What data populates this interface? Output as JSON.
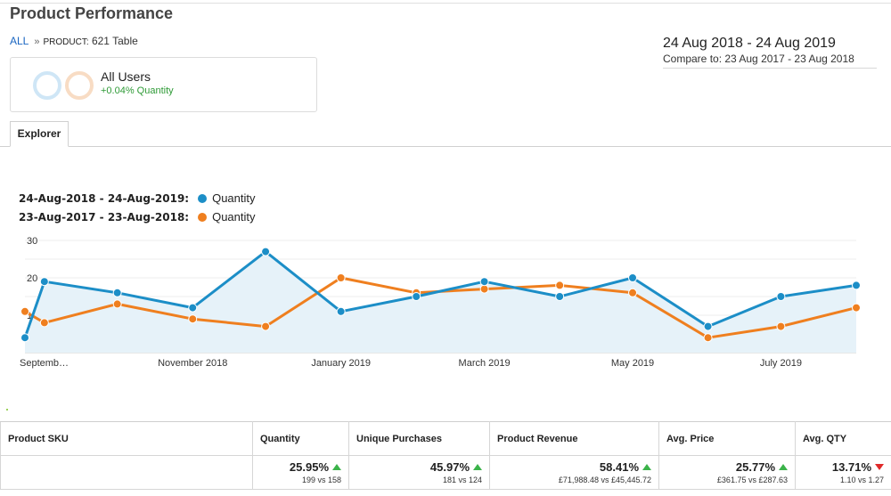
{
  "page": {
    "title": "Product Performance"
  },
  "breadcrumb": {
    "root": "ALL",
    "separator": "»",
    "key": "PRODUCT:",
    "value": "621 Table"
  },
  "date_range": {
    "main": "24 Aug 2018 - 24 Aug 2019",
    "compare": "Compare to: 23 Aug 2017 - 23 Aug 2018"
  },
  "segment": {
    "name": "All Users",
    "delta": "+0.04% Quantity"
  },
  "tabs": [
    {
      "label": "Explorer"
    }
  ],
  "colors": {
    "current": "#1c8ec7",
    "previous": "#ef7f1f",
    "up": "#3bb34a",
    "down": "#e02a2a"
  },
  "legend": [
    {
      "range": "24-Aug-2018 - 24-Aug-2019:",
      "metric": "Quantity",
      "color": "#1c8ec7"
    },
    {
      "range": "23-Aug-2017 - 23-Aug-2018:",
      "metric": "Quantity",
      "color": "#ef7f1f"
    }
  ],
  "chart_data": {
    "type": "line",
    "title": "",
    "xlabel": "",
    "ylabel": "",
    "ylim": [
      0,
      30
    ],
    "yticks": [
      10,
      20,
      30
    ],
    "xtick_labels": [
      "Septemb…",
      "November 2018",
      "January 2019",
      "March 2019",
      "May 2019",
      "July 2019"
    ],
    "grid": true,
    "series": [
      {
        "name": "24-Aug-2018 - 24-Aug-2019: Quantity",
        "color": "#1c8ec7",
        "area": true,
        "x": [
          "2018-08-24",
          "2018-09-01",
          "2018-10-01",
          "2018-11-01",
          "2018-12-01",
          "2019-01-01",
          "2019-02-01",
          "2019-03-01",
          "2019-04-01",
          "2019-05-01",
          "2019-06-01",
          "2019-07-01",
          "2019-08-01"
        ],
        "values": [
          4,
          19,
          16,
          12,
          27,
          11,
          15,
          19,
          15,
          20,
          7,
          15,
          18
        ]
      },
      {
        "name": "23-Aug-2017 - 23-Aug-2018: Quantity",
        "color": "#ef7f1f",
        "area": false,
        "x": [
          "2018-08-24",
          "2018-09-01",
          "2018-10-01",
          "2018-11-01",
          "2018-12-01",
          "2019-01-01",
          "2019-02-01",
          "2019-03-01",
          "2019-04-01",
          "2019-05-01",
          "2019-06-01",
          "2019-07-01",
          "2019-08-01"
        ],
        "values": [
          11,
          8,
          13,
          9,
          7,
          20,
          16,
          17,
          18,
          16,
          4,
          7,
          12
        ]
      }
    ]
  },
  "table": {
    "headers": [
      "Product SKU",
      "Quantity",
      "Unique Purchases",
      "Product Revenue",
      "Avg. Price",
      "Avg. QTY"
    ],
    "totals": [
      {
        "pct": "25.95%",
        "dir": "up",
        "compare": "199 vs 158"
      },
      {
        "pct": "45.97%",
        "dir": "up",
        "compare": "181 vs 124"
      },
      {
        "pct": "58.41%",
        "dir": "up",
        "compare": "£71,988.48 vs £45,445.72"
      },
      {
        "pct": "25.77%",
        "dir": "up",
        "compare": "£361.75 vs £287.63"
      },
      {
        "pct": "13.71%",
        "dir": "down",
        "compare": "1.10 vs 1.27"
      }
    ]
  }
}
